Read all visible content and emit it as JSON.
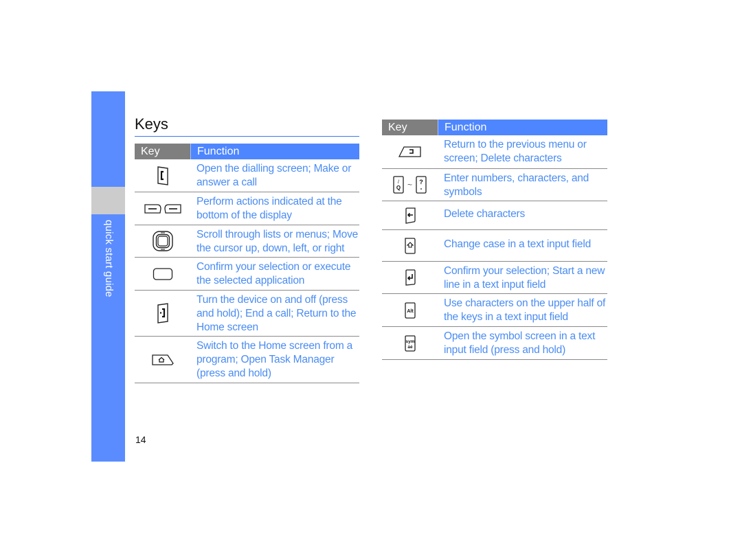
{
  "sidebar": {
    "section_label": "quick start guide",
    "accent_color": "#5b8cff"
  },
  "page": {
    "title": "Keys",
    "number": "14"
  },
  "tables": {
    "left": {
      "header": {
        "key": "Key",
        "function": "Function"
      },
      "rows": [
        {
          "icon": "dial-key-icon",
          "function": "Open the dialling screen; Make or answer a call"
        },
        {
          "icon": "softkeys-icon",
          "function": "Perform actions indicated at the bottom of the display"
        },
        {
          "icon": "navigation-key-icon",
          "function": "Scroll through lists or menus; Move the cursor up, down, left, or right"
        },
        {
          "icon": "confirm-key-icon",
          "function": "Confirm your selection or execute the selected application"
        },
        {
          "icon": "power-end-key-icon",
          "function": "Turn the device on and off (press and hold); End a call; Return to the Home screen"
        },
        {
          "icon": "home-key-icon",
          "function": "Switch to the Home screen from a program; Open Task Manager (press and hold)"
        }
      ]
    },
    "right": {
      "header": {
        "key": "Key",
        "function": "Function"
      },
      "rows": [
        {
          "icon": "back-key-icon",
          "function": "Return to the previous menu or screen; Delete characters"
        },
        {
          "icon": "alphanumeric-keys-icon",
          "range_separator": "~",
          "function": "Enter numbers, characters, and symbols"
        },
        {
          "icon": "delete-key-icon",
          "function": "Delete characters"
        },
        {
          "icon": "shift-key-icon",
          "function": "Change case in a text input field"
        },
        {
          "icon": "enter-key-icon",
          "function": "Confirm your selection; Start a new line in a text input field"
        },
        {
          "icon": "alt-key-icon",
          "key_text": "Alt",
          "function": "Use characters on the upper half of the keys in a text input field"
        },
        {
          "icon": "sym-key-icon",
          "key_text_top": "sym",
          "key_text_bottom": "áé",
          "function": "Open the symbol screen in a text input field (press and hold)"
        }
      ]
    }
  }
}
